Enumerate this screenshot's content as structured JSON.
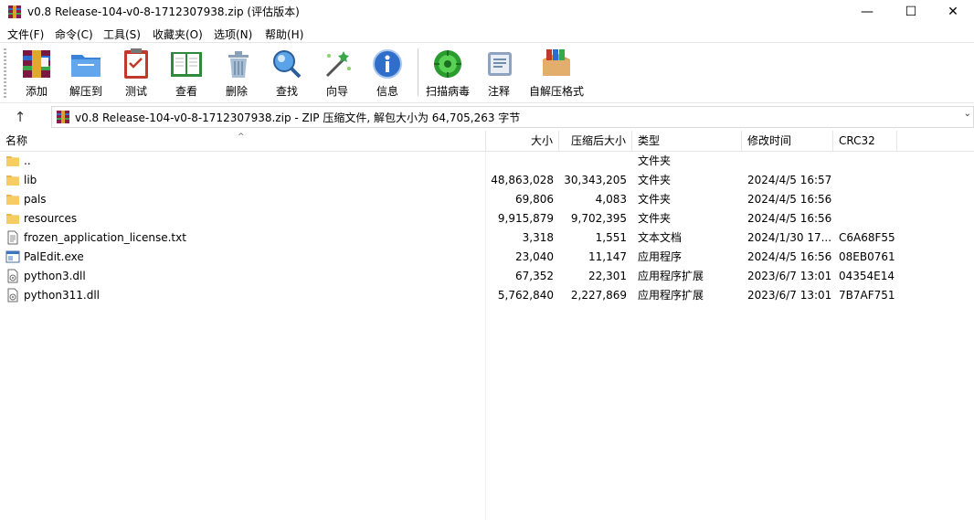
{
  "window": {
    "title": "v0.8 Release-104-v0-8-1712307938.zip (评估版本)",
    "minimize": "—",
    "maximize": "☐",
    "close": "✕"
  },
  "menu": [
    "文件(F)",
    "命令(C)",
    "工具(S)",
    "收藏夹(O)",
    "选项(N)",
    "帮助(H)"
  ],
  "toolbar": [
    {
      "label": "添加",
      "icon": "rar-add-icon"
    },
    {
      "label": "解压到",
      "icon": "extract-folder-icon"
    },
    {
      "label": "测试",
      "icon": "test-clipboard-icon"
    },
    {
      "label": "查看",
      "icon": "view-book-icon"
    },
    {
      "label": "删除",
      "icon": "trash-icon"
    },
    {
      "label": "查找",
      "icon": "magnifier-icon"
    },
    {
      "label": "向导",
      "icon": "wizard-wand-icon"
    },
    {
      "label": "信息",
      "icon": "info-icon"
    },
    {
      "label": "扫描病毒",
      "icon": "virus-scan-icon"
    },
    {
      "label": "注释",
      "icon": "comment-icon"
    },
    {
      "label": "自解压格式",
      "icon": "sfx-box-icon"
    }
  ],
  "address": {
    "up": "↑",
    "text": "v0.8 Release-104-v0-8-1712307938.zip - ZIP 压缩文件, 解包大小为 64,705,263 字节",
    "dropdown": "⌄"
  },
  "columns": {
    "name": "名称",
    "size": "大小",
    "packed": "压缩后大小",
    "type": "类型",
    "mtime": "修改时间",
    "crc": "CRC32"
  },
  "files": [
    {
      "name": "..",
      "size": "",
      "packed": "",
      "type": "文件夹",
      "mtime": "",
      "crc": "",
      "icon": "folder"
    },
    {
      "name": "lib",
      "size": "48,863,028",
      "packed": "30,343,205",
      "type": "文件夹",
      "mtime": "2024/4/5 16:57",
      "crc": "",
      "icon": "folder"
    },
    {
      "name": "pals",
      "size": "69,806",
      "packed": "4,083",
      "type": "文件夹",
      "mtime": "2024/4/5 16:56",
      "crc": "",
      "icon": "folder"
    },
    {
      "name": "resources",
      "size": "9,915,879",
      "packed": "9,702,395",
      "type": "文件夹",
      "mtime": "2024/4/5 16:56",
      "crc": "",
      "icon": "folder"
    },
    {
      "name": "frozen_application_license.txt",
      "size": "3,318",
      "packed": "1,551",
      "type": "文本文档",
      "mtime": "2024/1/30 17...",
      "crc": "C6A68F55",
      "icon": "text"
    },
    {
      "name": "PalEdit.exe",
      "size": "23,040",
      "packed": "11,147",
      "type": "应用程序",
      "mtime": "2024/4/5 16:56",
      "crc": "08EB0761",
      "icon": "exe"
    },
    {
      "name": "python3.dll",
      "size": "67,352",
      "packed": "22,301",
      "type": "应用程序扩展",
      "mtime": "2023/6/7 13:01",
      "crc": "04354E14",
      "icon": "dll"
    },
    {
      "name": "python311.dll",
      "size": "5,762,840",
      "packed": "2,227,869",
      "type": "应用程序扩展",
      "mtime": "2023/6/7 13:01",
      "crc": "7B7AF751",
      "icon": "dll"
    }
  ]
}
